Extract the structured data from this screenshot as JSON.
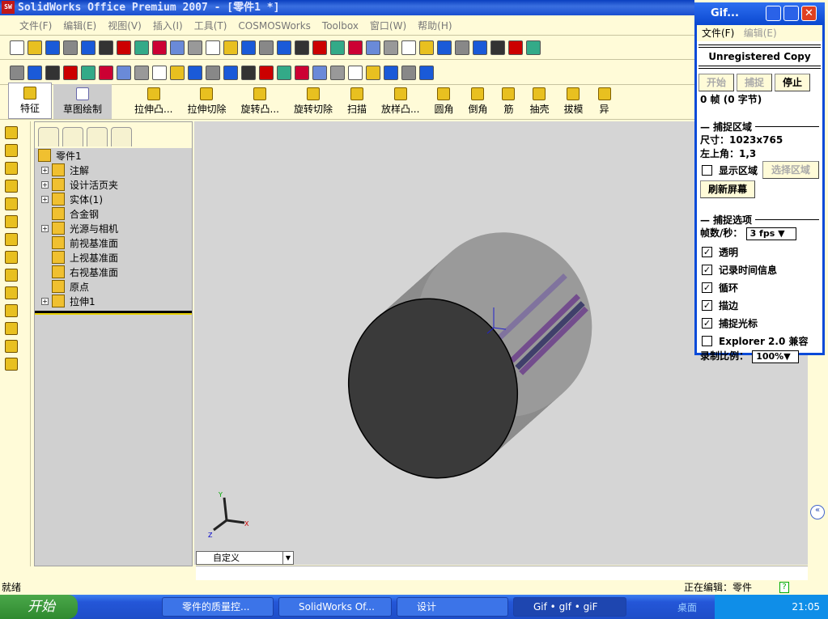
{
  "window": {
    "title": "SolidWorks Office Premium 2007 - [零件1 *]",
    "logo": "SW"
  },
  "menu": [
    "文件(F)",
    "编辑(E)",
    "视图(V)",
    "插入(I)",
    "工具(T)",
    "COSMOSWorks",
    "Toolbox",
    "窗口(W)",
    "帮助(H)"
  ],
  "command_manager": {
    "tabs": [
      "特征",
      "草图绘制"
    ],
    "buttons": [
      "拉伸凸...",
      "拉伸切除",
      "旋转凸...",
      "旋转切除",
      "扫描",
      "放样凸...",
      "圆角",
      "倒角",
      "筋",
      "抽壳",
      "拔模",
      "异"
    ]
  },
  "tree": {
    "root": "零件1",
    "items": [
      {
        "label": "注解",
        "expandable": true
      },
      {
        "label": "设计活页夹",
        "expandable": true
      },
      {
        "label": "实体(1)",
        "expandable": true
      },
      {
        "label": "合金钢",
        "expandable": false
      },
      {
        "label": "光源与相机",
        "expandable": true
      },
      {
        "label": "前视基准面",
        "expandable": false
      },
      {
        "label": "上视基准面",
        "expandable": false
      },
      {
        "label": "右视基准面",
        "expandable": false
      },
      {
        "label": "原点",
        "expandable": false
      },
      {
        "label": "拉伸1",
        "expandable": true
      }
    ]
  },
  "viewport": {
    "view_combo": "自定义",
    "triad": {
      "x": "X",
      "y": "Y",
      "z": "Z"
    }
  },
  "status": {
    "left": "就绪",
    "right": "正在编辑：零件"
  },
  "taskbar": {
    "start": "开始",
    "tasks": [
      "零件的质量控...",
      "SolidWorks Of...",
      "设计",
      "Gif • gIf • giF"
    ],
    "desktop": "桌面",
    "clock": "21:05"
  },
  "gif_window": {
    "title": "Gif...",
    "menu": [
      "文件(F)",
      "编辑(E)"
    ],
    "banner": "Unregistered Copy",
    "buttons": {
      "start": "开始",
      "capture": "捕捉",
      "stop": "停止"
    },
    "frames": "0 帧 (0 字节)",
    "capture_area": {
      "heading": "捕捉区域",
      "size": "尺寸：1023x765",
      "corner": "左上角：1,3",
      "show_area": "显示区域",
      "show_area_checked": false,
      "select_area": "选择区域",
      "refresh": "刷新屏幕"
    },
    "options": {
      "heading": "捕捉选项",
      "fps_label": "帧数/秒：",
      "fps": "3 fps",
      "checks": [
        {
          "label": "透明",
          "checked": true
        },
        {
          "label": "记录时间信息",
          "checked": true
        },
        {
          "label": "循环",
          "checked": true
        },
        {
          "label": "描边",
          "checked": true
        },
        {
          "label": "捕捉光标",
          "checked": true
        },
        {
          "label": "Explorer 2.0 兼容",
          "checked": false
        }
      ],
      "scale_label": "录制比例：",
      "scale": "100%"
    }
  },
  "colors": {
    "accent": "#0a4ad8",
    "toolbar_bg": "#fffbd8",
    "viewport_bg": "#d5d5d5",
    "model_side": "#8c8c8c",
    "model_face": "#3a3a3a",
    "stripe": "#6a3a8a"
  }
}
